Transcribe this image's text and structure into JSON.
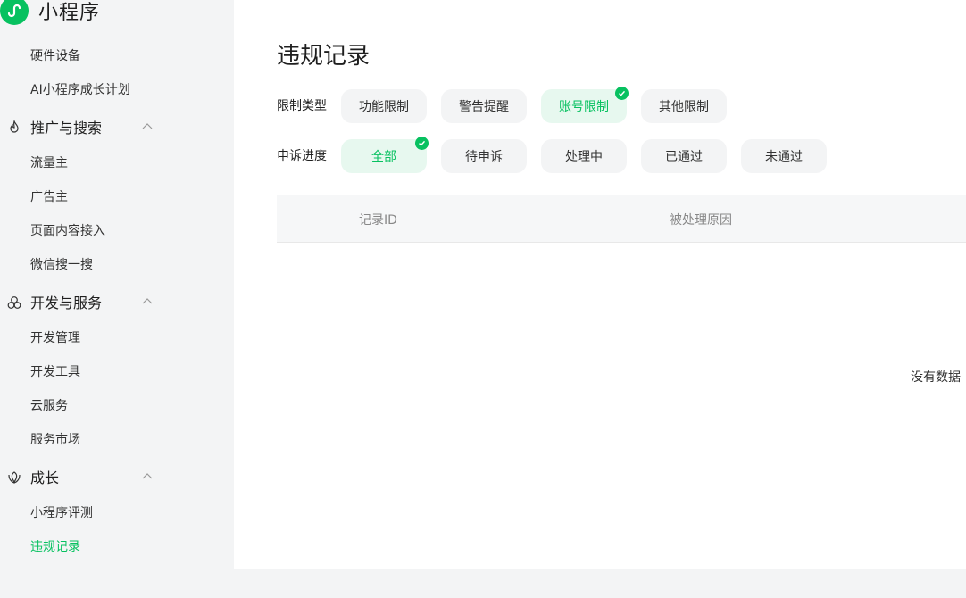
{
  "brand": {
    "name": "小程序"
  },
  "sidebar": {
    "top_items": [
      {
        "label": "硬件设备"
      },
      {
        "label": "AI小程序成长计划"
      }
    ],
    "groups": [
      {
        "label": "推广与搜索",
        "icon": "flame-icon",
        "items": [
          {
            "label": "流量主"
          },
          {
            "label": "广告主"
          },
          {
            "label": "页面内容接入"
          },
          {
            "label": "微信搜一搜"
          }
        ]
      },
      {
        "label": "开发与服务",
        "icon": "cluster-icon",
        "items": [
          {
            "label": "开发管理"
          },
          {
            "label": "开发工具"
          },
          {
            "label": "云服务"
          },
          {
            "label": "服务市场"
          }
        ]
      },
      {
        "label": "成长",
        "icon": "growth-icon",
        "items": [
          {
            "label": "小程序评测"
          },
          {
            "label": "违规记录",
            "active": true
          }
        ]
      }
    ]
  },
  "main": {
    "title": "违规记录",
    "filters": [
      {
        "label": "限制类型",
        "options": [
          {
            "label": "功能限制",
            "selected": false
          },
          {
            "label": "警告提醒",
            "selected": false
          },
          {
            "label": "账号限制",
            "selected": true
          },
          {
            "label": "其他限制",
            "selected": false
          }
        ]
      },
      {
        "label": "申诉进度",
        "options": [
          {
            "label": "全部",
            "selected": true
          },
          {
            "label": "待申诉",
            "selected": false
          },
          {
            "label": "处理中",
            "selected": false
          },
          {
            "label": "已通过",
            "selected": false
          },
          {
            "label": "未通过",
            "selected": false
          }
        ]
      }
    ],
    "table": {
      "columns": [
        {
          "label": "记录ID"
        },
        {
          "label": "被处理原因"
        }
      ],
      "empty_text": "没有数据"
    }
  },
  "colors": {
    "accent": "#07c160",
    "accent_bg": "#e7f8ef",
    "chip_bg": "#f3f4f5"
  }
}
